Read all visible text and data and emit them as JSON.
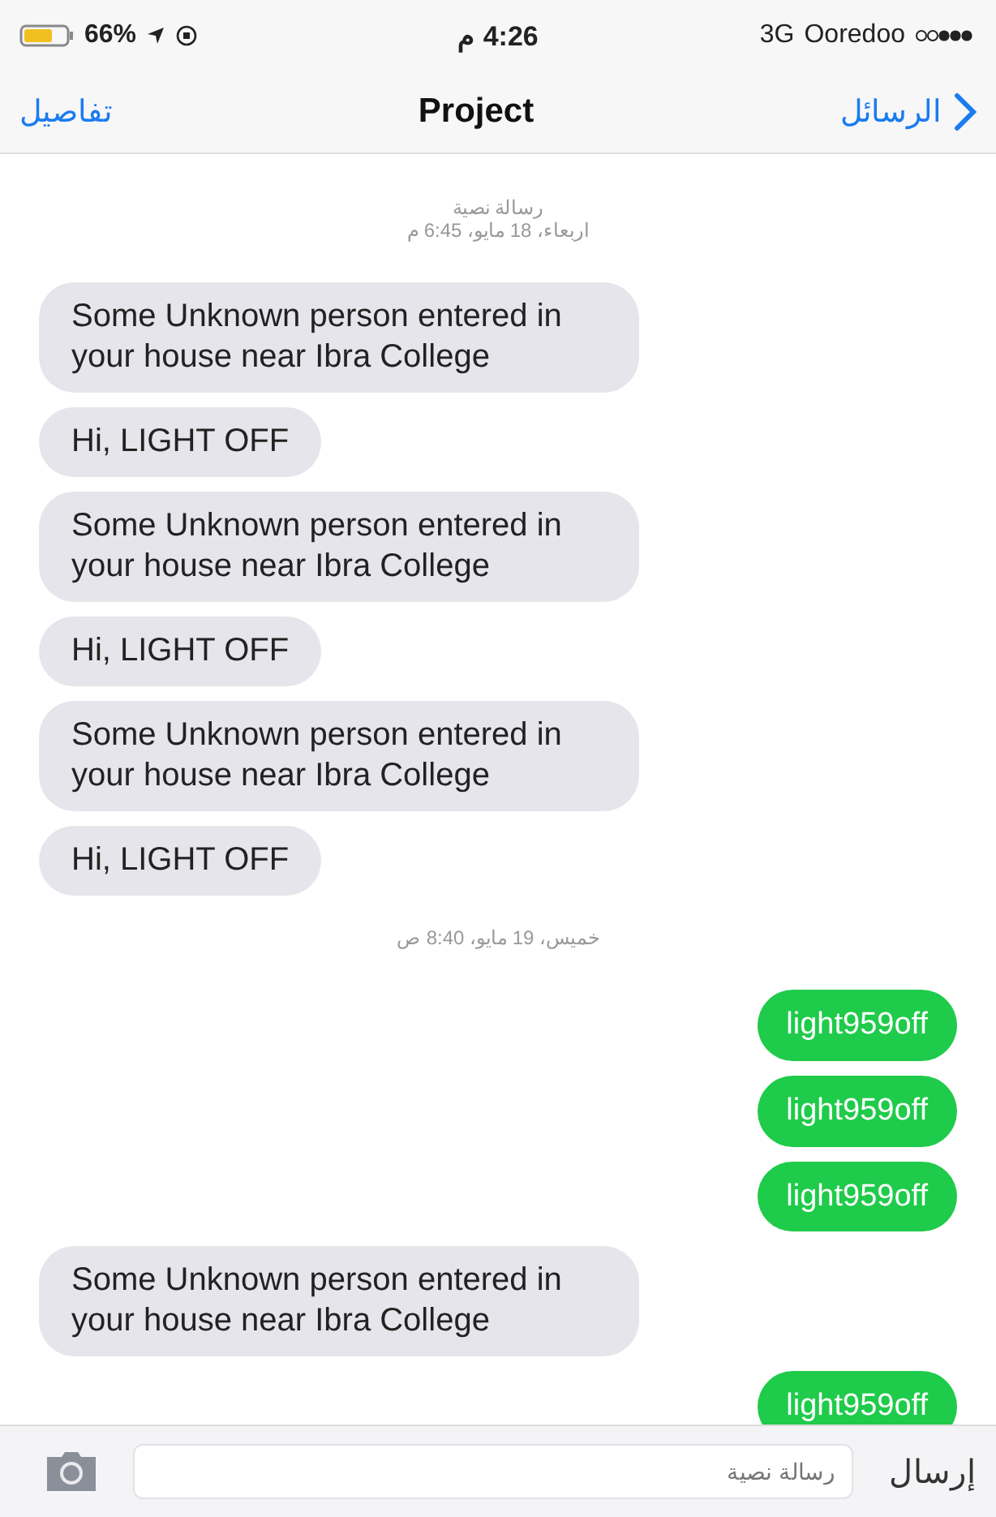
{
  "status_bar": {
    "battery": "66%",
    "time": "4:26 م",
    "network": "3G",
    "carrier": "Ooredoo"
  },
  "nav": {
    "back": "الرسائل",
    "title": "Project",
    "details": "تفاصيل"
  },
  "messages": [
    {
      "kind": "timestamp",
      "lines": [
        "رسالة نصية",
        "اربعاء، 18 مايو، 6:45 م"
      ]
    },
    {
      "kind": "received",
      "text": "Some Unknown person entered in your house near Ibra College"
    },
    {
      "kind": "received",
      "text": "Hi, LIGHT OFF"
    },
    {
      "kind": "received",
      "text": "Some Unknown person entered in your house near Ibra College"
    },
    {
      "kind": "received",
      "text": "Hi, LIGHT OFF"
    },
    {
      "kind": "received",
      "text": "Some Unknown person entered in your house near Ibra College"
    },
    {
      "kind": "received",
      "text": "Hi, LIGHT OFF"
    },
    {
      "kind": "timestamp",
      "lines": [
        "خميس، 19 مايو، 8:40 ص"
      ]
    },
    {
      "kind": "sent",
      "text": "light959off"
    },
    {
      "kind": "sent",
      "text": "light959off"
    },
    {
      "kind": "sent",
      "text": "light959off"
    },
    {
      "kind": "received",
      "text": "Some Unknown person entered in your house near Ibra College"
    },
    {
      "kind": "sent",
      "text": "light959off"
    }
  ],
  "composer": {
    "placeholder": "رسالة نصية",
    "send": "إرسال"
  }
}
